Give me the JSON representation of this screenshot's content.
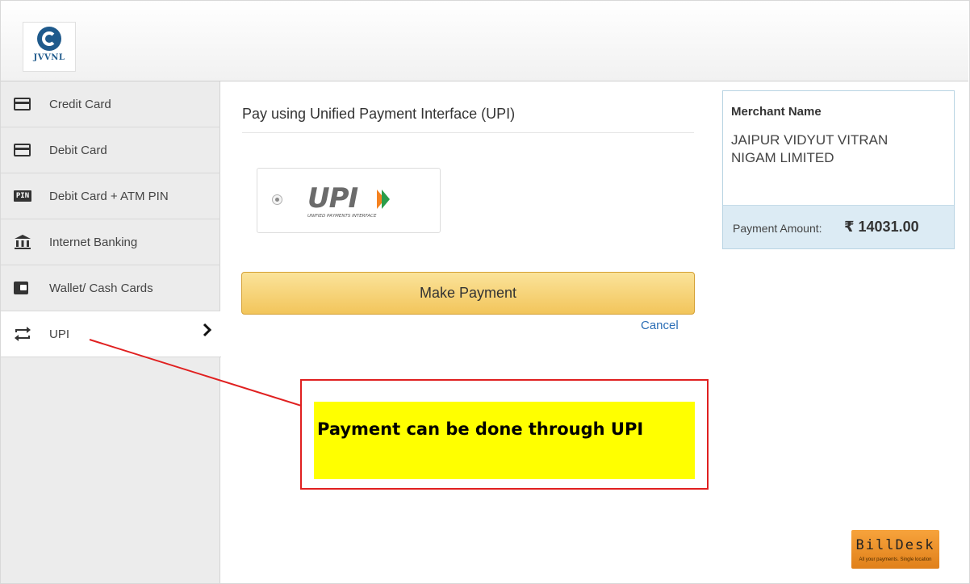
{
  "header": {
    "logo_text": "JVVNL"
  },
  "sidebar": {
    "items": [
      {
        "label": "Credit Card",
        "icon": "credit-card-icon"
      },
      {
        "label": "Debit Card",
        "icon": "debit-card-icon"
      },
      {
        "label": "Debit Card + ATM PIN",
        "icon": "pin-icon",
        "icon_text": "PIN"
      },
      {
        "label": "Internet Banking",
        "icon": "bank-icon"
      },
      {
        "label": "Wallet/ Cash Cards",
        "icon": "wallet-icon"
      },
      {
        "label": "UPI",
        "icon": "transfer-icon",
        "active": true,
        "chevron": "›"
      }
    ]
  },
  "main": {
    "title": "Pay using Unified Payment Interface (UPI)",
    "upi_option": {
      "logo_word": "UPI",
      "logo_caption": "UNIFIED PAYMENTS INTERFACE",
      "selected": true
    },
    "make_payment_label": "Make Payment",
    "cancel_label": "Cancel"
  },
  "merchant": {
    "heading": "Merchant Name",
    "name": "JAIPUR VIDYUT VITRAN NIGAM LIMITED",
    "amount_label": "Payment Amount:",
    "amount": "₹ 14031.00"
  },
  "annotation": {
    "text": "Payment can be done through UPI"
  },
  "footer": {
    "brand": "BillDesk",
    "tagline": "All your payments. Single location"
  },
  "colors": {
    "accent_button": "#f2c55b",
    "link": "#2a6db5",
    "merchant_panel": "#dcebf4",
    "annotation_border": "#e02020",
    "annotation_highlight": "#ffff00"
  }
}
